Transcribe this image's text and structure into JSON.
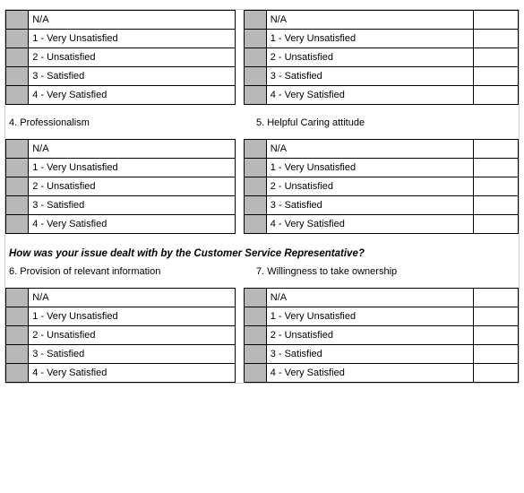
{
  "rating_scale": {
    "0": "N/A",
    "1": "1 - Very Unsatisfied",
    "2": "2 - Unsatisfied",
    "3": "3 - Satisfied",
    "4": "4 - Very Satisfied"
  },
  "questions": {
    "q4": "4. Professionalism",
    "q5": "5. Helpful Caring attitude",
    "q6": "6. Provision of relevant information",
    "q7": "7. Willingness to take ownership"
  },
  "section_heading": "How was your issue dealt with by the Customer Service Representative?"
}
